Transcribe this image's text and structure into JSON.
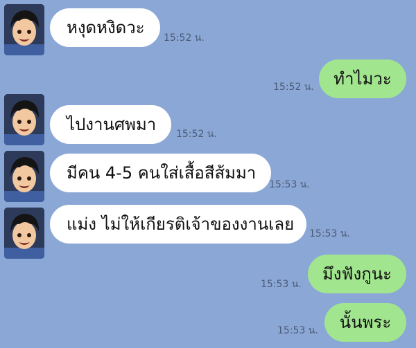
{
  "colors": {
    "background": "#8aa7d6",
    "incoming_bubble": "#ffffff",
    "outgoing_bubble": "#a2e58f",
    "timestamp": "#4c5b76"
  },
  "messages": [
    {
      "direction": "incoming",
      "text": "หงุดหงิดวะ",
      "time": "15:52 น.",
      "avatar": "friend-avatar"
    },
    {
      "direction": "outgoing",
      "text": "ทำไมวะ",
      "time": "15:52 น."
    },
    {
      "direction": "incoming",
      "text": "ไปงานศพมา",
      "time": "15:52 น.",
      "avatar": "friend-avatar"
    },
    {
      "direction": "incoming",
      "text": "มีคน 4-5 คนใส่เสื้อสีส้มมา",
      "time": "15:53 น.",
      "avatar": "friend-avatar"
    },
    {
      "direction": "incoming",
      "text": "แม่ง  ไม่ให้เกียรติเจ้าของงานเลย",
      "time": "15:53 น.",
      "avatar": "friend-avatar"
    },
    {
      "direction": "outgoing",
      "text": "มึงฟังกูนะ",
      "time": "15:53 น."
    },
    {
      "direction": "outgoing",
      "text": "นั้นพระ",
      "time": "15:53 น."
    }
  ]
}
